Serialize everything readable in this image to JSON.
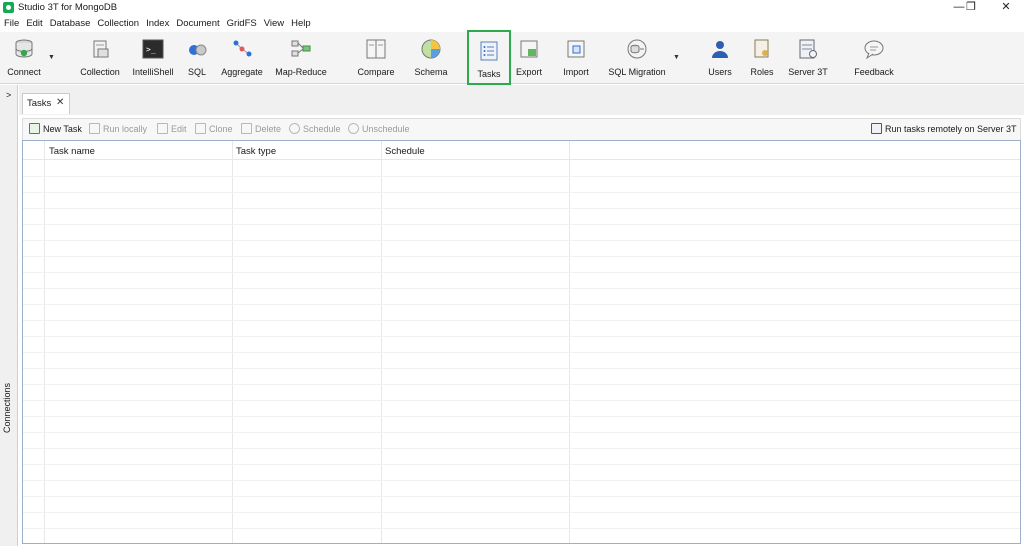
{
  "window": {
    "title": "Studio 3T for MongoDB",
    "minimize": "—",
    "restore": "❐",
    "close": "✕"
  },
  "menu": [
    "File",
    "Edit",
    "Database",
    "Collection",
    "Index",
    "Document",
    "GridFS",
    "View",
    "Help"
  ],
  "toolbar": {
    "connect": "Connect",
    "collection": "Collection",
    "intellishell": "IntelliShell",
    "sql": "SQL",
    "aggregate": "Aggregate",
    "map_reduce": "Map-Reduce",
    "compare": "Compare",
    "schema": "Schema",
    "tasks": "Tasks",
    "export": "Export",
    "import": "Import",
    "sql_migration": "SQL Migration",
    "users": "Users",
    "roles": "Roles",
    "server3t": "Server 3T",
    "feedback": "Feedback",
    "active_highlight": "#2fa94e"
  },
  "sidebar": {
    "connections_label": "Connections",
    "expand": ">"
  },
  "tabs": [
    {
      "label": "Tasks",
      "close": "✕"
    }
  ],
  "actions": {
    "new_task": "New Task",
    "run_locally": "Run locally",
    "edit": "Edit",
    "clone": "Clone",
    "delete": "Delete",
    "schedule": "Schedule",
    "unschedule": "Unschedule",
    "run_remote": "Run tasks remotely on Server 3T"
  },
  "table": {
    "columns": [
      "Task name",
      "Task type",
      "Schedule"
    ],
    "rows": []
  }
}
